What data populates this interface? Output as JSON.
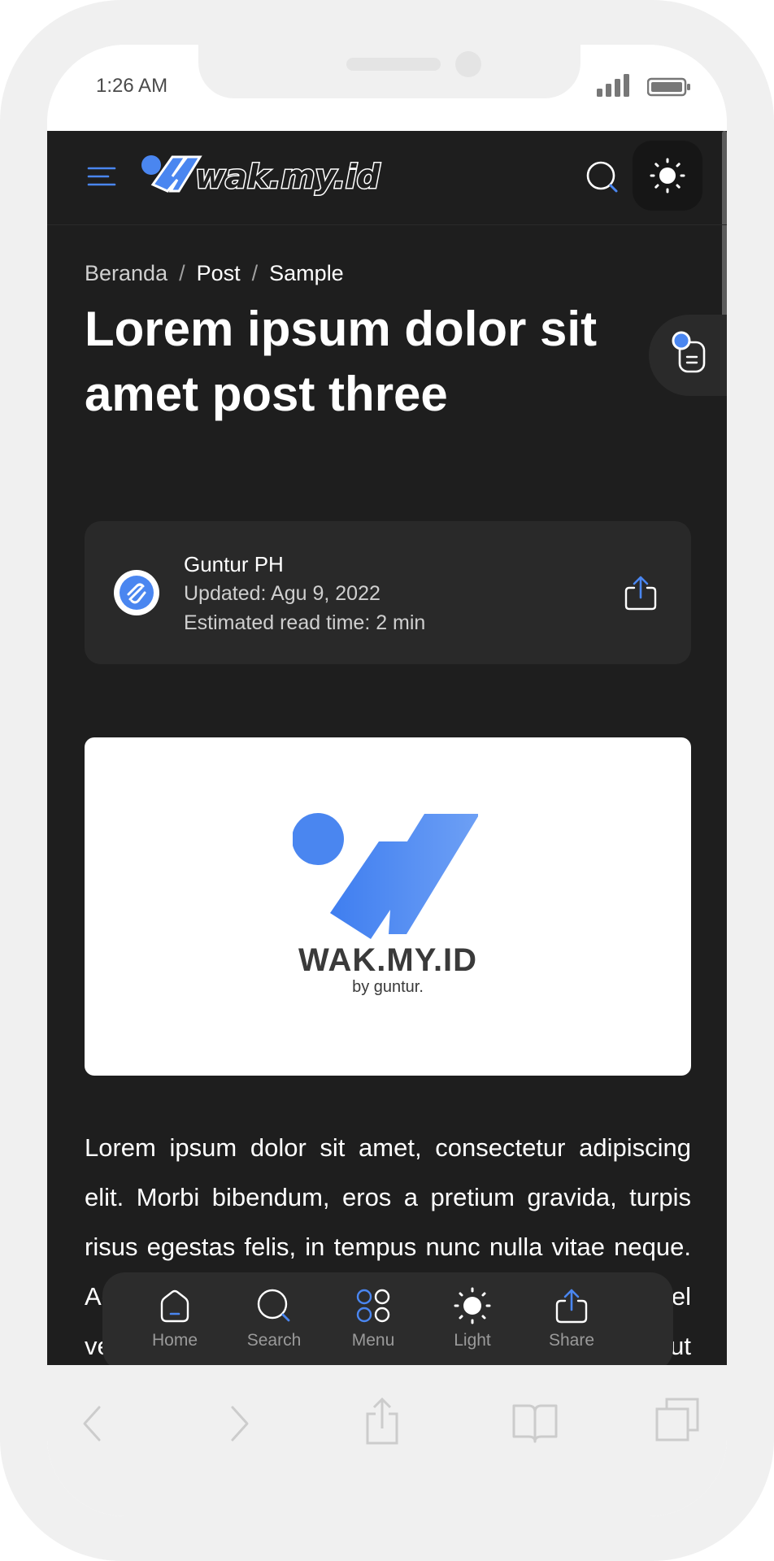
{
  "status_bar": {
    "time": "1:26 AM"
  },
  "header": {
    "logo_text": "wak.my.id",
    "icons": [
      "menu-icon",
      "search-icon",
      "sun-icon"
    ]
  },
  "breadcrumb": {
    "home": "Beranda",
    "section": "Post",
    "current": "Sample",
    "separator": "/"
  },
  "post": {
    "title": "Lorem ipsum dolor sit amet post three",
    "author": "Guntur PH",
    "updated": "Updated: Agu 9, 2022",
    "read_time": "Estimated read time: 2 min"
  },
  "featured_image": {
    "brand": "WAK.MY.ID",
    "tagline": "by guntur."
  },
  "article": {
    "text": "Lorem ipsum dolor sit amet, consectetur adipiscing elit. Morbi bibendum, eros a pretium gravida, turpis risus egestas felis, in tempus nunc nulla vitae neque. Aenean quis lacus vitae tortor a cursus. Integer vel velit vel massa gravida lobortis efficitur nulla quam ut odio. Aliquam consequat"
  },
  "bottom_nav": {
    "items": [
      {
        "label": "Home",
        "icon": "home-icon"
      },
      {
        "label": "Search",
        "icon": "search-icon"
      },
      {
        "label": "Menu",
        "icon": "menu-grid-icon"
      },
      {
        "label": "Light",
        "icon": "sun-icon"
      },
      {
        "label": "Share",
        "icon": "share-icon"
      }
    ]
  },
  "colors": {
    "accent": "#4a86f0",
    "background": "#1e1e1e",
    "card": "#292929",
    "text": "#ffffff",
    "muted": "#9a9a9a"
  }
}
